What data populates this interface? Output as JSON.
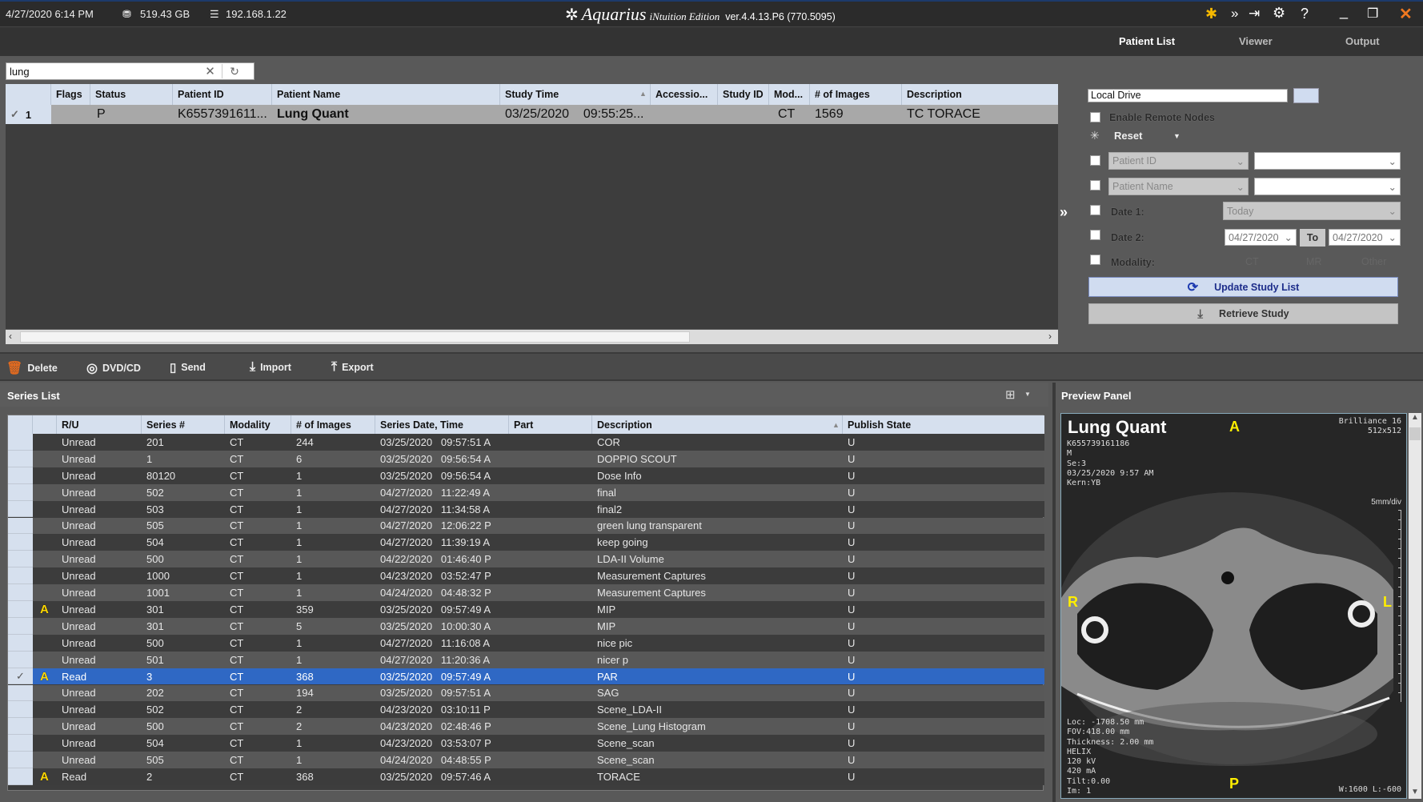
{
  "titlebar": {
    "datetime": "4/27/2020  6:14 PM",
    "disk": "519.43 GB",
    "ip": "192.168.1.22",
    "app_name": "Aquarius",
    "app_edition": "iNtuition Edition",
    "version": "ver.4.4.13.P6 (770.5095)"
  },
  "nav": {
    "tabs": [
      {
        "label": "Patient List",
        "active": true
      },
      {
        "label": "Viewer"
      },
      {
        "label": "Output"
      }
    ]
  },
  "search": {
    "value": "lung"
  },
  "study_table": {
    "columns": [
      "",
      "Flags",
      "Status",
      "Patient ID",
      "Patient Name",
      "Study Time",
      "Accessio...",
      "Study ID",
      "Mod...",
      "# of Images",
      "Description"
    ],
    "rows": [
      {
        "index": "1",
        "flags": "",
        "status": "P",
        "patient_id": "K6557391611...",
        "patient_name": "Lung Quant",
        "study_time": "03/25/2020    09:55:25...",
        "accession": "",
        "study_id": "",
        "modality": "CT",
        "images": "1569",
        "description": "TC TORACE"
      }
    ]
  },
  "query": {
    "source": "Local Drive",
    "enable_remote": "Enable Remote Nodes",
    "reset": "Reset",
    "field1": "Patient ID",
    "field2": "Patient Name",
    "date1_label": "Date 1:",
    "date1_value": "Today",
    "date2_label": "Date 2:",
    "date_from": "04/27/2020",
    "to": "To",
    "date_to": "04/27/2020",
    "modality_label": "Modality:",
    "modalities": [
      "CT",
      "MR",
      "Other"
    ],
    "update": "Update Study List",
    "retrieve": "Retrieve Study"
  },
  "toolbar": {
    "delete": "Delete",
    "dvd": "DVD/CD",
    "send": "Send",
    "import": "Import",
    "export": "Export"
  },
  "series": {
    "title": "Series List",
    "columns": [
      "R/U",
      "Series #",
      "Modality",
      "# of Images",
      "Series Date, Time",
      "Part",
      "Description",
      "Publish State"
    ],
    "rows": [
      [
        "",
        "",
        "Unread",
        "201",
        "CT",
        "244",
        "03/25/2020   09:57:51 A",
        "",
        "COR",
        "U"
      ],
      [
        "",
        "",
        "Unread",
        "1",
        "CT",
        "6",
        "03/25/2020   09:56:54 A",
        "",
        "DOPPIO SCOUT",
        "U"
      ],
      [
        "",
        "",
        "Unread",
        "80120",
        "CT",
        "1",
        "03/25/2020   09:56:54 A",
        "",
        "Dose Info",
        "U"
      ],
      [
        "",
        "",
        "Unread",
        "502",
        "CT",
        "1",
        "04/27/2020   11:22:49 A",
        "",
        "final",
        "U"
      ],
      [
        "",
        "",
        "Unread",
        "503",
        "CT",
        "1",
        "04/27/2020   11:34:58 A",
        "",
        "final2",
        "U"
      ],
      [
        "",
        "",
        "Unread",
        "505",
        "CT",
        "1",
        "04/27/2020   12:06:22 P",
        "",
        "green lung transparent",
        "U"
      ],
      [
        "",
        "",
        "Unread",
        "504",
        "CT",
        "1",
        "04/27/2020   11:39:19 A",
        "",
        "keep going",
        "U"
      ],
      [
        "",
        "",
        "Unread",
        "500",
        "CT",
        "1",
        "04/22/2020   01:46:40 P",
        "",
        "LDA-II Volume",
        "U"
      ],
      [
        "",
        "",
        "Unread",
        "1000",
        "CT",
        "1",
        "04/23/2020   03:52:47 P",
        "",
        "Measurement Captures",
        "U"
      ],
      [
        "",
        "",
        "Unread",
        "1001",
        "CT",
        "1",
        "04/24/2020   04:48:32 P",
        "",
        "Measurement Captures",
        "U"
      ],
      [
        "",
        "A",
        "Unread",
        "301",
        "CT",
        "359",
        "03/25/2020   09:57:49 A",
        "",
        "MIP",
        "U"
      ],
      [
        "",
        "",
        "Unread",
        "301",
        "CT",
        "5",
        "03/25/2020   10:00:30 A",
        "",
        "MIP",
        "U"
      ],
      [
        "",
        "",
        "Unread",
        "500",
        "CT",
        "1",
        "04/27/2020   11:16:08 A",
        "",
        "nice pic",
        "U"
      ],
      [
        "",
        "",
        "Unread",
        "501",
        "CT",
        "1",
        "04/27/2020   11:20:36 A",
        "",
        "nicer p",
        "U"
      ],
      [
        "✓",
        "A",
        "Read",
        "3",
        "CT",
        "368",
        "03/25/2020   09:57:49 A",
        "",
        "PAR",
        "U"
      ],
      [
        "",
        "",
        "Unread",
        "202",
        "CT",
        "194",
        "03/25/2020   09:57:51 A",
        "",
        "SAG",
        "U"
      ],
      [
        "",
        "",
        "Unread",
        "502",
        "CT",
        "2",
        "04/23/2020   03:10:11 P",
        "",
        "Scene_LDA-II",
        "U"
      ],
      [
        "",
        "",
        "Unread",
        "500",
        "CT",
        "2",
        "04/23/2020   02:48:46 P",
        "",
        "Scene_Lung Histogram",
        "U"
      ],
      [
        "",
        "",
        "Unread",
        "504",
        "CT",
        "1",
        "04/23/2020   03:53:07 P",
        "",
        "Scene_scan",
        "U"
      ],
      [
        "",
        "",
        "Unread",
        "505",
        "CT",
        "1",
        "04/24/2020   04:48:55 P",
        "",
        "Scene_scan",
        "U"
      ],
      [
        "",
        "A",
        "Read",
        "2",
        "CT",
        "368",
        "03/25/2020   09:57:46 A",
        "",
        "TORACE",
        "U"
      ]
    ],
    "selected_index": 14
  },
  "preview": {
    "title": "Preview Panel",
    "patient_name": "Lung Quant",
    "top_marker": "A",
    "bottom_marker": "P",
    "left_marker": "R",
    "right_marker": "L",
    "top_left": "K655739161186\nM\nSe:3\n03/25/2020 9:57 AM\nKern:YB",
    "top_right": "Brilliance 16\n512x512",
    "scale": "5mm/div",
    "bottom_left": "Loc: -1708.50 mm\nFOV:418.00 mm\nThickness: 2.00 mm\nHELIX\n120 kV\n420 mA\nTilt:0.00\nIm: 1",
    "window_level": "W:1600 L:-600"
  },
  "colors": {
    "selected_row": "#2f68c4",
    "header": "#d6e0ee",
    "flag": "#ffd800",
    "update_button": "#d0dcf0"
  }
}
